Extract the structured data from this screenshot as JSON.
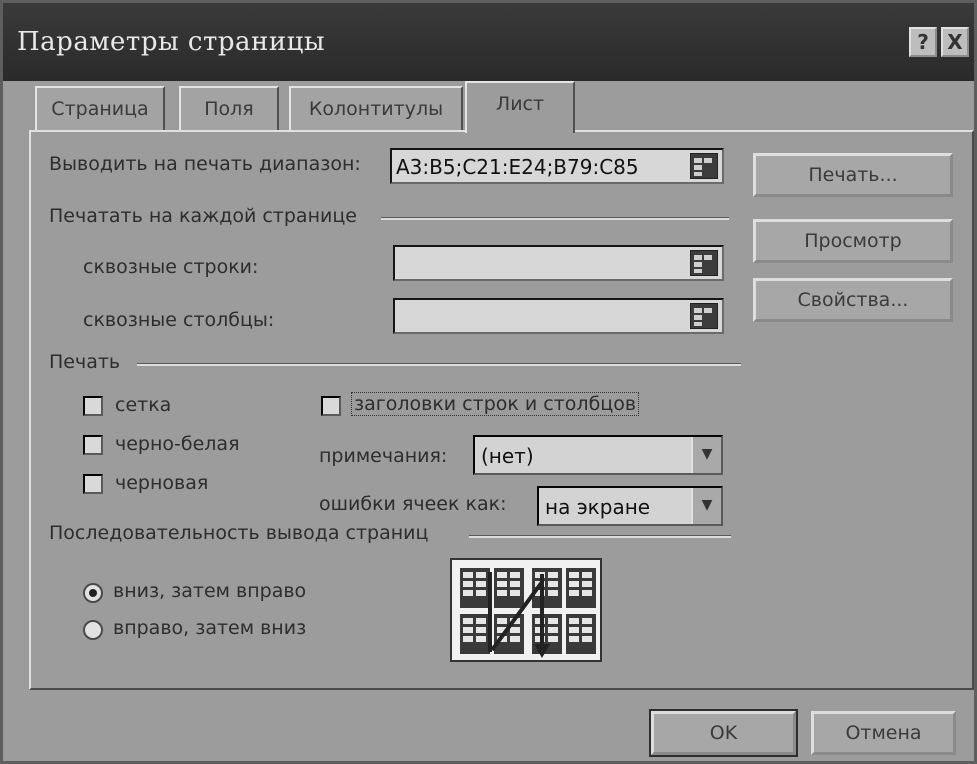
{
  "dialog": {
    "title": "Параметры страницы",
    "help_label": "?",
    "close_label": "X"
  },
  "tabs": [
    {
      "label": "Страница",
      "active": false
    },
    {
      "label": "Поля",
      "active": false
    },
    {
      "label": "Колонтитулы",
      "active": false
    },
    {
      "label": "Лист",
      "active": true
    }
  ],
  "print_area": {
    "label": "Выводить на печать диапазон:",
    "value": "A3:B5;C21:E24;B79:C85"
  },
  "print_titles": {
    "group_label": "Печатать на каждой странице",
    "rows_label": "сквозные строки:",
    "rows_value": "",
    "cols_label": "сквозные столбцы:",
    "cols_value": ""
  },
  "print": {
    "group_label": "Печать",
    "gridlines_label": "сетка",
    "gridlines_checked": false,
    "bw_label": "черно-белая",
    "bw_checked": false,
    "draft_label": "черновая",
    "draft_checked": false,
    "headings_label": "заголовки строк и столбцов",
    "headings_checked": false,
    "comments_label": "примечания:",
    "comments_value": "(нет)",
    "errors_label": "ошибки ячеек как:",
    "errors_value": "на экране"
  },
  "page_order": {
    "group_label": "Последовательность вывода страниц",
    "down_then_over_label": "вниз, затем вправо",
    "over_then_down_label": "вправо, затем вниз",
    "selected": "down_then_over"
  },
  "buttons": {
    "print": "Печать...",
    "preview": "Просмотр",
    "options": "Свойства...",
    "ok": "OK",
    "cancel": "Отмена"
  },
  "icons": {
    "range_picker": "range-picker-icon",
    "dropdown": "chevron-down-icon"
  }
}
